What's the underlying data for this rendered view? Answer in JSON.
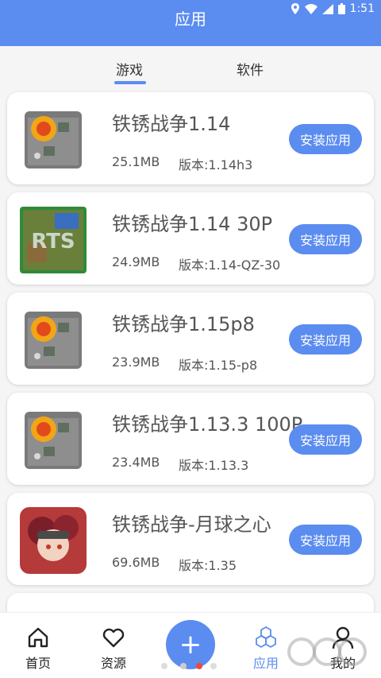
{
  "status_bar": {
    "time": "1:51"
  },
  "header": {
    "title": "应用"
  },
  "tabs": [
    {
      "label": "游戏",
      "active": true
    },
    {
      "label": "软件",
      "active": false
    }
  ],
  "apps": [
    {
      "name": "铁锈战争1.14",
      "size": "25.1MB",
      "version": "版本:1.14h3",
      "button": "安装应用",
      "icon": "tank-explosion-icon"
    },
    {
      "name": "铁锈战争1.14 30P",
      "size": "24.9MB",
      "version": "版本:1.14-QZ-30",
      "button": "安装应用",
      "icon": "rts-map-icon"
    },
    {
      "name": "铁锈战争1.15p8",
      "size": "23.9MB",
      "version": "版本:1.15-p8",
      "button": "安装应用",
      "icon": "tank-explosion-icon"
    },
    {
      "name": "铁锈战争1.13.3 100P",
      "size": "23.4MB",
      "version": "版本:1.13.3",
      "button": "安装应用",
      "icon": "tank-explosion-icon"
    },
    {
      "name": "铁锈战争-月球之心",
      "size": "69.6MB",
      "version": "版本:1.35",
      "button": "安装应用",
      "icon": "anime-girl-icon"
    }
  ],
  "bottom_nav": [
    {
      "label": "首页",
      "icon": "home-icon",
      "active": false
    },
    {
      "label": "资源",
      "icon": "heart-icon",
      "active": false
    },
    {
      "label": "应用",
      "icon": "hexagons-icon",
      "active": true
    },
    {
      "label": "我的",
      "icon": "person-icon",
      "active": false
    }
  ],
  "colors": {
    "accent": "#5b8cf0",
    "background": "#f5f5f5"
  }
}
